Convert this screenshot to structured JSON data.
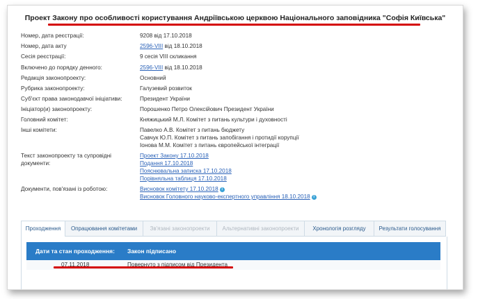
{
  "title": "Проект Закону про особливості користування Андріївською церквою Національного заповідника \"Софія Київська\"",
  "fields": [
    {
      "label": "Номер, дата реєстрації:",
      "values": [
        "9208 від 17.10.2018"
      ],
      "link": false
    },
    {
      "label": "Номер, дата акту",
      "values": [
        "2596-VIII від 18.10.2018"
      ],
      "link_part": "2596-VIII",
      "rest": " від 18.10.2018"
    },
    {
      "label": "Сесія реєстрації:",
      "values": [
        "9 сесія VIII скликання"
      ]
    },
    {
      "label": "Включено до порядку денного:",
      "values": [
        "2596-VIII від 18.10.2018"
      ],
      "link_part": "2596-VIII",
      "rest": " від 18.10.2018"
    },
    {
      "label": "Редакція законопроекту:",
      "values": [
        "Основний"
      ]
    },
    {
      "label": "Рубрика законопроекту:",
      "values": [
        "Галузевий розвиток"
      ]
    },
    {
      "label": "Суб'єкт права законодавчої ініціативи:",
      "values": [
        "Президент України"
      ]
    },
    {
      "label": "Ініціатор(и) законопроекту:",
      "values": [
        "Порошенко Петро Олексійович Президент України"
      ]
    },
    {
      "label": "Головний комітет:",
      "values": [
        "Княжицький М.Л. Комітет з питань культури і духовності"
      ]
    },
    {
      "label": "Інші комітети:",
      "values": [
        "Павелко А.В. Комітет з питань бюджету",
        "Савчук Ю.П. Комітет з питань запобігання і протидії корупції",
        "Іонова М.М. Комітет з питань європейської інтеграції"
      ]
    },
    {
      "label": "Текст законопроекту та супровідні документи:",
      "links": [
        "Проект Закону 17.10.2018",
        "Подання 17.10.2018",
        "Пояснювальна записка 17.10.2018",
        "Порівняльна таблиця 17.10.2018"
      ]
    },
    {
      "label": "Документи, пов'язані із роботою:",
      "links": [
        "Висновок комітету 17.10.2018",
        "Висновок Головного науково-експертного управління 18.10.2018"
      ]
    }
  ],
  "tabs": [
    "Проходження",
    "Опрацювання комітетами",
    "Зв'язані законопроекти",
    "Альтернативні законопроекти",
    "Хронологія розгляду",
    "Результати голосування"
  ],
  "table": {
    "header": [
      "Дати та стан проходження:",
      "Закон підписано"
    ],
    "rows": [
      [
        "07.11.2018",
        "Повернуто з підписом від Президента"
      ]
    ]
  },
  "icons": {
    "info": "info-icon"
  },
  "colors": {
    "accent": "#2a7cc7",
    "link": "#2a62b8",
    "annotation": "#d40000"
  }
}
